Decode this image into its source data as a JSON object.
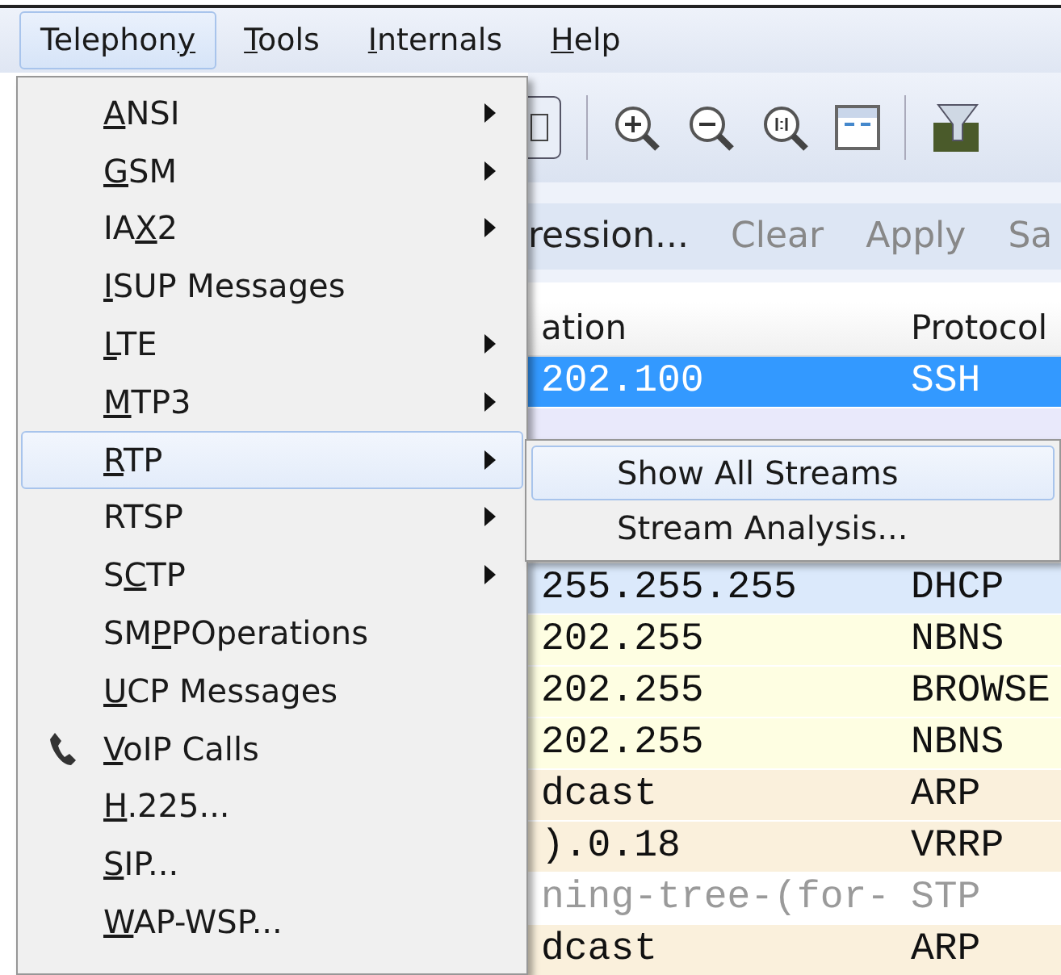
{
  "menubar": [
    {
      "pre": "Telephon",
      "key": "y",
      "selected": true
    },
    {
      "key": "T",
      "post": "ools",
      "selected": false
    },
    {
      "key": "I",
      "post": "nternals",
      "selected": false
    },
    {
      "key": "H",
      "post": "elp",
      "selected": false
    }
  ],
  "filter_bar": [
    {
      "label": "ression...",
      "disabled": false
    },
    {
      "label": "Clear",
      "disabled": true
    },
    {
      "label": "Apply",
      "disabled": true
    },
    {
      "label": "Sa",
      "disabled": true
    }
  ],
  "packet_list": {
    "columns": [
      "ation",
      "Protocol"
    ],
    "rows": [
      {
        "cells": [
          "202.100",
          "SSH"
        ],
        "selected": true,
        "color": "#3399ff"
      },
      {
        "kind": "covered",
        "color": "#e9e9fb"
      },
      {
        "kind": "hidden"
      },
      {
        "kind": "hidden"
      },
      {
        "cells": [
          "255.255.255",
          "DHCP"
        ],
        "selected": false,
        "color": "#dbe9fb"
      },
      {
        "cells": [
          "202.255",
          "NBNS"
        ],
        "selected": false,
        "color": "#fefee2"
      },
      {
        "cells": [
          "202.255",
          "BROWSE"
        ],
        "selected": false,
        "color": "#fefee2"
      },
      {
        "cells": [
          "202.255",
          "NBNS"
        ],
        "selected": false,
        "color": "#fefee2"
      },
      {
        "cells": [
          "dcast",
          "ARP"
        ],
        "selected": false,
        "color": "#faf0dc"
      },
      {
        "cells": [
          ").0.18",
          "VRRP"
        ],
        "selected": false,
        "color": "#faf0dc"
      },
      {
        "cells": [
          "ning-tree-(for-",
          "STP"
        ],
        "selected": false,
        "color": "#ffffff",
        "disabled": true
      },
      {
        "cells": [
          "dcast",
          "ARP"
        ],
        "selected": false,
        "color": "#faf0dc"
      }
    ]
  },
  "menu": [
    {
      "key": "A",
      "post": "NSI",
      "submenu": true,
      "selected": false,
      "kind": "plain"
    },
    {
      "key": "G",
      "post": "SM",
      "submenu": true,
      "selected": false,
      "kind": "plain"
    },
    {
      "pre": "IA",
      "key": "X",
      "post": "2",
      "submenu": true,
      "selected": false,
      "kind": "plain"
    },
    {
      "key": "I",
      "post": "SUP Messages",
      "submenu": false,
      "selected": false,
      "kind": "plain"
    },
    {
      "key": "L",
      "post": "TE",
      "submenu": true,
      "selected": false,
      "kind": "plain"
    },
    {
      "key": "M",
      "post": "TP3",
      "submenu": true,
      "selected": false,
      "kind": "plain"
    },
    {
      "key": "R",
      "post": "TP",
      "submenu": true,
      "selected": true,
      "kind": "plain"
    },
    {
      "pre": "RTSP",
      "submenu": true,
      "selected": false,
      "kind": "plain"
    },
    {
      "pre": "S",
      "key": "C",
      "post": "TP",
      "submenu": true,
      "selected": false,
      "kind": "plain"
    },
    {
      "pre": "SM",
      "key": "P",
      "post": "POperations",
      "submenu": false,
      "selected": false,
      "kind": "plain"
    },
    {
      "key": "U",
      "post": "CP Messages",
      "submenu": false,
      "selected": false,
      "kind": "plain"
    },
    {
      "key": "V",
      "post": "oIP Calls",
      "submenu": false,
      "selected": false,
      "kind": "iconed"
    },
    {
      "key": "H",
      "post": ".225...",
      "submenu": false,
      "selected": false,
      "kind": "plain"
    },
    {
      "key": "S",
      "post": "IP...",
      "submenu": false,
      "selected": false,
      "kind": "plain"
    },
    {
      "key": "W",
      "post": "AP-WSP...",
      "submenu": false,
      "selected": false,
      "kind": "plain"
    }
  ],
  "submenu": [
    {
      "label": "Show All Streams",
      "selected": true
    },
    {
      "label": "Stream Analysis...",
      "selected": false
    }
  ]
}
